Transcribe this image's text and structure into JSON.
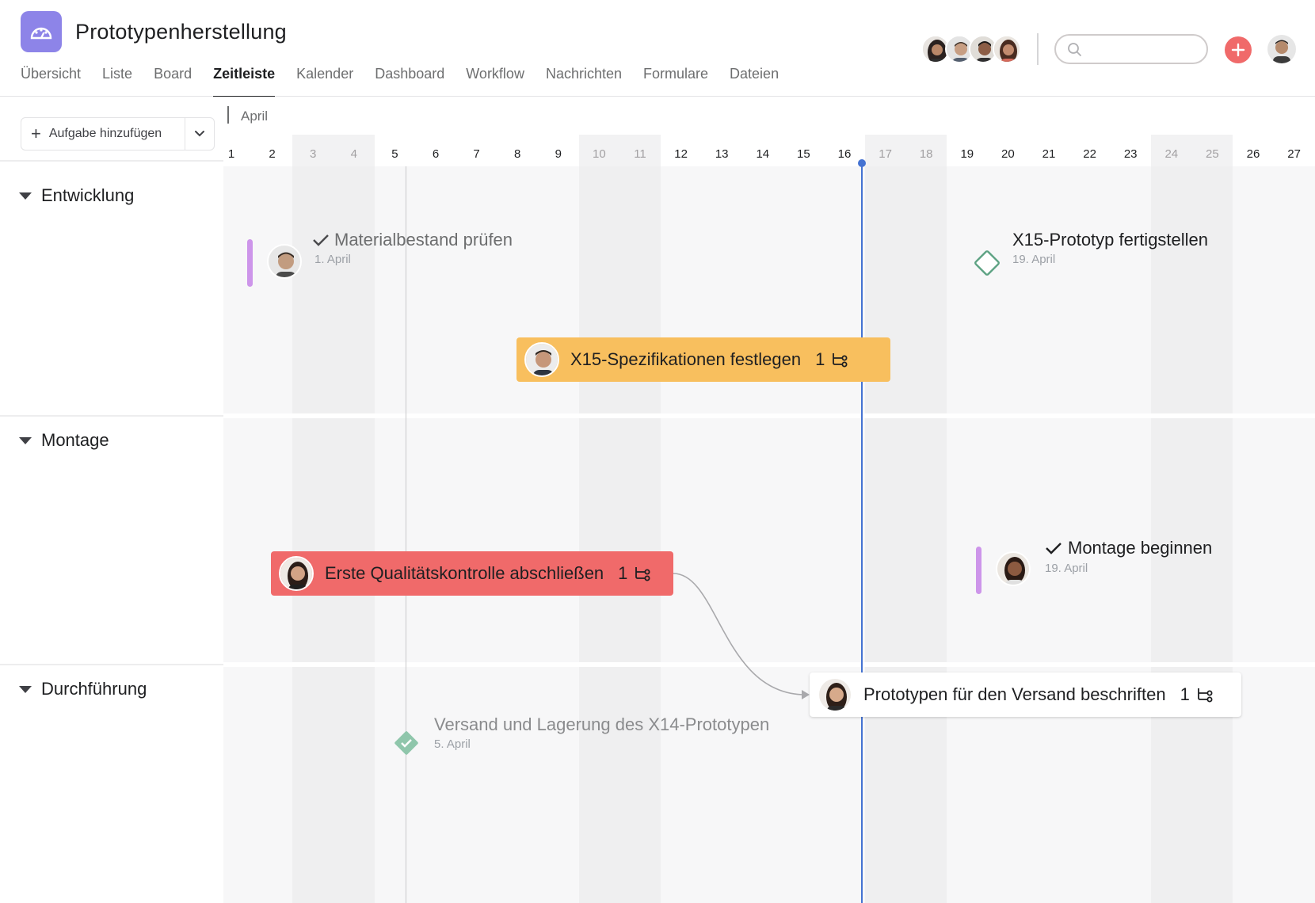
{
  "project": {
    "title": "Prototypenherstellung",
    "icon": "dashboard-gauge-icon"
  },
  "tabs": [
    "Übersicht",
    "Liste",
    "Board",
    "Zeitleiste",
    "Kalender",
    "Dashboard",
    "Workflow",
    "Nachrichten",
    "Formulare",
    "Dateien"
  ],
  "active_tab": "Zeitleiste",
  "header": {
    "members": [
      "member-1",
      "member-2",
      "member-3",
      "member-4"
    ],
    "search": {
      "placeholder": ""
    }
  },
  "toolbar": {
    "add_task_label": "Aufgabe hinzufügen"
  },
  "timeline": {
    "month": "April",
    "days": [
      "1",
      "2",
      "3",
      "4",
      "5",
      "6",
      "7",
      "8",
      "9",
      "10",
      "11",
      "12",
      "13",
      "14",
      "15",
      "16",
      "17",
      "18",
      "19",
      "20",
      "21",
      "22",
      "23",
      "24",
      "25",
      "26",
      "27"
    ],
    "weekend_days": [
      "3",
      "4",
      "10",
      "11",
      "17",
      "18",
      "24",
      "25"
    ],
    "today": "16"
  },
  "sections": [
    {
      "name": "Entwicklung"
    },
    {
      "name": "Montage"
    },
    {
      "name": "Durchführung"
    }
  ],
  "tasks": {
    "materialbestand": {
      "title": "Materialbestand prüfen",
      "date": "1. April",
      "status": "completed"
    },
    "x15_prototyp": {
      "title": "X15-Prototyp fertigstellen",
      "date": "19. April",
      "type": "milestone"
    },
    "x15_spezifikationen": {
      "title": "X15-Spezifikationen festlegen",
      "subtasks": "1",
      "color": "#f8bf5e"
    },
    "qualitaetskontrolle": {
      "title": "Erste Qualitätskontrolle abschließen",
      "subtasks": "1",
      "color": "#f06a6a"
    },
    "montage_beginnen": {
      "title": "Montage beginnen",
      "date": "19. April",
      "status": "completed"
    },
    "prototypen_versand": {
      "title": "Prototypen für den Versand beschriften",
      "subtasks": "1",
      "color": "#ffffff"
    },
    "versand_lagerung": {
      "title": "Versand und Lagerung des X14-Prototypen",
      "date": "5. April",
      "status": "completed-milestone"
    }
  }
}
